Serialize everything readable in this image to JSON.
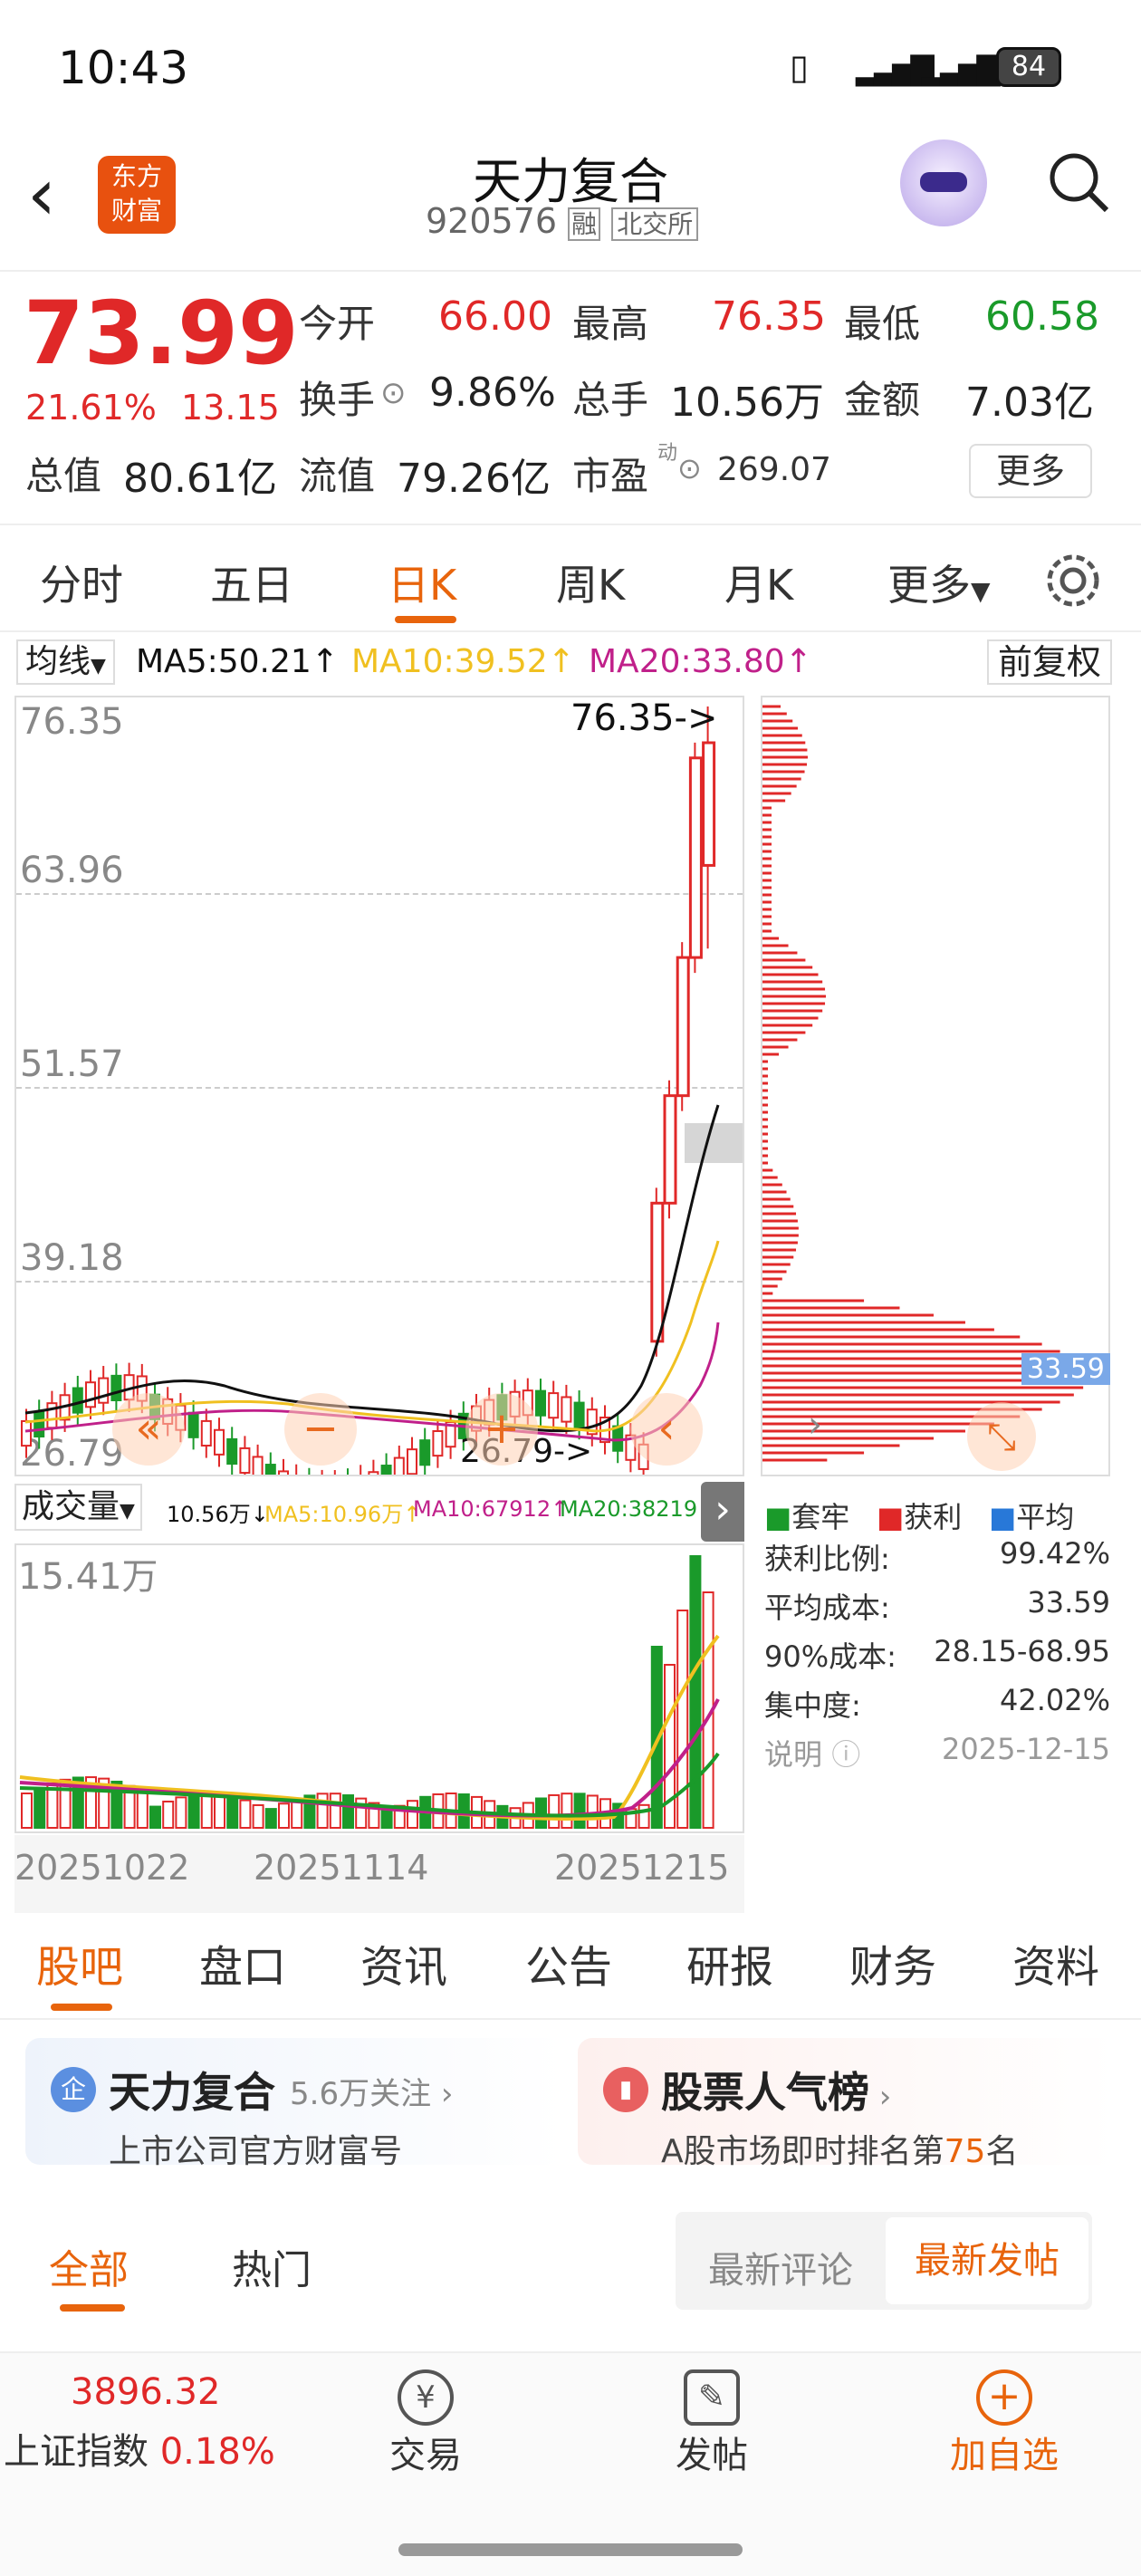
{
  "status": {
    "time": "10:43",
    "battery": "84"
  },
  "header": {
    "name": "天力复合",
    "code": "920576",
    "tag1": "融",
    "tag2": "北交所",
    "logo_line1": "东方",
    "logo_line2": "财富"
  },
  "quote": {
    "price": "73.99",
    "change_pct": "21.61%",
    "change": "13.15",
    "items": [
      {
        "label": "今开",
        "value": "66.00",
        "color": "red"
      },
      {
        "label": "最高",
        "value": "76.35",
        "color": "red"
      },
      {
        "label": "最低",
        "value": "60.58",
        "color": "green"
      },
      {
        "label": "换手",
        "value": "9.86%",
        "color": "dark"
      },
      {
        "label": "总手",
        "value": "10.56万",
        "color": "dark"
      },
      {
        "label": "金额",
        "value": "7.03亿",
        "color": "dark"
      },
      {
        "label": "总值",
        "value": "80.61亿",
        "color": "dark"
      },
      {
        "label": "流值",
        "value": "79.26亿",
        "color": "dark"
      },
      {
        "label": "市盈",
        "value": "269.07",
        "color": "dark"
      }
    ],
    "more": "更多",
    "pe_sup": "动"
  },
  "tabs": [
    "分时",
    "五日",
    "日K",
    "周K",
    "月K",
    "更多"
  ],
  "indicator": {
    "name": "均线",
    "ma5": "MA5:50.21",
    "ma10": "MA10:39.52",
    "ma20": "MA20:33.80",
    "fq": "前复权"
  },
  "kchart": {
    "y_labels": [
      "76.35",
      "63.96",
      "51.57",
      "39.18",
      "26.79"
    ],
    "high_label": "76.35->",
    "low_label": "26.79->"
  },
  "volume": {
    "name": "成交量",
    "value": "10.56万",
    "ma5": "MA5:10.96万",
    "ma10": "MA10:67912",
    "ma20": "MA20:38219",
    "max": "15.41万",
    "dates": [
      "20251022",
      "20251114",
      "20251215"
    ]
  },
  "chip": {
    "cost_tag": "33.59",
    "legend": [
      "套牢",
      "获利",
      "平均"
    ],
    "rows": [
      {
        "label": "获利比例:",
        "value": "99.42%"
      },
      {
        "label": "平均成本:",
        "value": "33.59"
      },
      {
        "label": "90%成本:",
        "value": "28.15-68.95"
      },
      {
        "label": "集中度:",
        "value": "42.02%"
      },
      {
        "label": "说明",
        "value": "2025-12-15"
      }
    ]
  },
  "colors": {
    "red": "#e02828",
    "green": "#1a9a2a",
    "ma5": "#111111",
    "ma10": "#f0c020",
    "ma20": "#c0208a",
    "accent": "#e8640c"
  },
  "chart_data": {
    "type": "candlestick",
    "date_range": [
      "20251022",
      "20251215"
    ],
    "price_range": [
      26.79,
      76.35
    ],
    "last_candles": [
      {
        "open": 35,
        "close": 44
      },
      {
        "open": 44,
        "close": 51
      },
      {
        "open": 51,
        "close": 60
      },
      {
        "open": 60,
        "close": 73
      },
      {
        "open": 66,
        "close": 73.99,
        "high": 76.35,
        "low": 60.58
      }
    ]
  },
  "bottom_tabs": [
    "股吧",
    "盘口",
    "资讯",
    "公告",
    "研报",
    "财务",
    "资料"
  ],
  "card1": {
    "title": "天力复合",
    "follow": "5.6万关注",
    "sub": "上市公司官方财富号"
  },
  "card2": {
    "title": "股票人气榜",
    "sub_pre": "A股市场即时排名第",
    "rank": "75",
    "sub_post": "名"
  },
  "feed": {
    "tab_all": "全部",
    "tab_hot": "热门",
    "sort_latest_comment": "最新评论",
    "sort_latest_post": "最新发帖"
  },
  "footer": {
    "index_value": "3896.32",
    "index_name": "上证指数",
    "index_pct": "0.18%",
    "trade": "交易",
    "post": "发帖",
    "add": "加自选"
  }
}
